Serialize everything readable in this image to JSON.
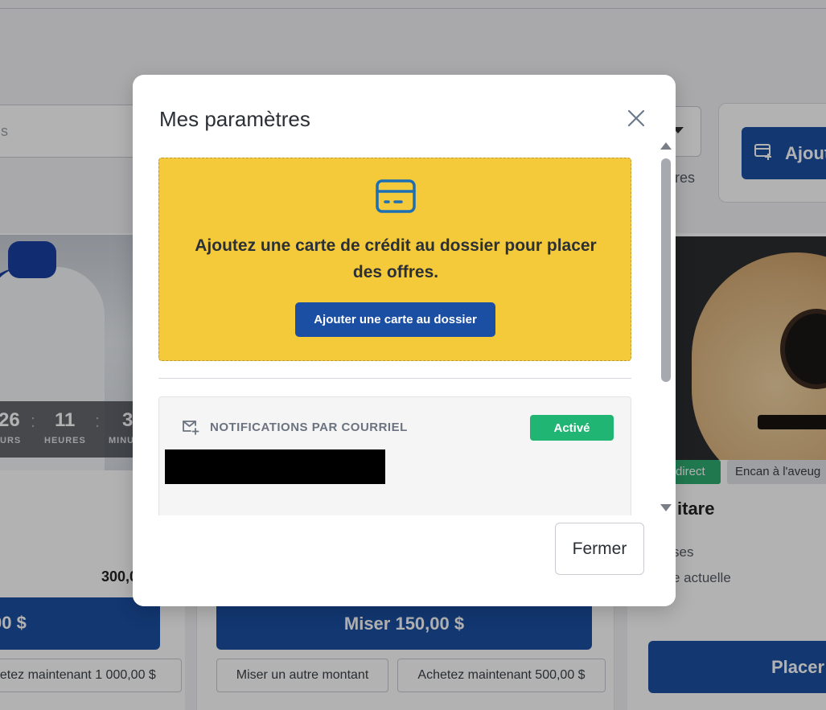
{
  "background": {
    "search": {
      "placeholder_fragment": "s"
    },
    "filters": {
      "hint_fragment": "fres"
    },
    "add_button": {
      "label_fragment": "Ajout"
    },
    "left_card": {
      "countdown": [
        {
          "value": "26",
          "unit": "URS"
        },
        {
          "value": "11",
          "unit": "HEURES"
        },
        {
          "value": "3",
          "unit": "MINU"
        }
      ],
      "price_fragment": "300,0",
      "bid_fragment": "00 $",
      "buy_fragment": "hetez maintenant 1 000,00 $"
    },
    "middle_card": {
      "bid_label": "Miser 150,00 $",
      "other_amount_label": "Miser un autre montant",
      "buy_label": "Achetez maintenant 500,00 $"
    },
    "right_card": {
      "tag_direct": "direct",
      "tag_blind": "Encan à l'aveug",
      "title_fragment": "itare",
      "line1_fragment": "ses",
      "line2_fragment": "e actuelle",
      "place_fragment": "Placer"
    }
  },
  "modal": {
    "title": "Mes paramètres",
    "credit_card_banner": {
      "icon": "credit-card-icon",
      "message": "Ajoutez une carte de crédit au dossier pour placer des offres.",
      "button_label": "Ajouter une carte au dossier",
      "background_color": "#f5ca3a"
    },
    "email_notifications": {
      "icon": "mail-plus-icon",
      "label": "NOTIFICATIONS PAR COURRIEL",
      "status": "Activé",
      "status_color": "#21b573"
    },
    "footer": {
      "close_label": "Fermer"
    }
  },
  "colors": {
    "primary": "#1b4fa3",
    "success": "#21b573",
    "warning": "#f5ca3a"
  }
}
